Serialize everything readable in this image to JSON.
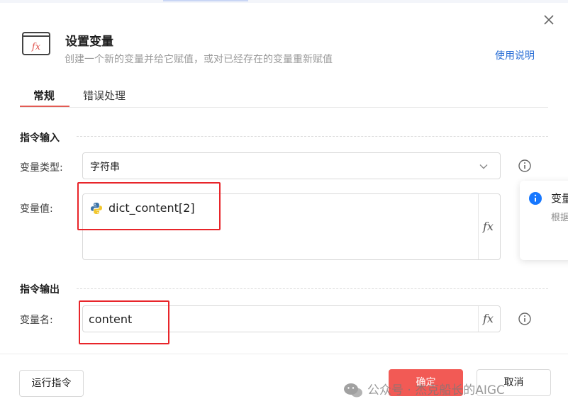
{
  "dialog": {
    "title": "设置变量",
    "subtitle": "创建一个新的变量并给它赋值，或对已经存在的变量重新赋值",
    "help_link": "使用说明"
  },
  "tabs": [
    {
      "label": "常规",
      "active": true
    },
    {
      "label": "错误处理",
      "active": false
    }
  ],
  "input_section": {
    "title": "指令输入",
    "type_field": {
      "label": "变量类型:",
      "value": "字符串"
    },
    "value_field": {
      "label": "变量值:",
      "value": "dict_content[2]",
      "icon": "python-icon"
    }
  },
  "output_section": {
    "title": "指令输出",
    "name_field": {
      "label": "变量名:",
      "value": "content"
    }
  },
  "fx_label": "fx",
  "popover": {
    "title": "变量",
    "subtitle": "根据"
  },
  "footer": {
    "run_button": "运行指令",
    "ok_button": "确定",
    "cancel_button": "取消"
  },
  "watermark": "公众号 · 杰克船长的AIGC",
  "colors": {
    "accent": "#f25a55",
    "tab_underline": "#e25b54",
    "link": "#2b6fd6",
    "highlight_box": "#e8252a",
    "info_blue": "#1677ff"
  }
}
